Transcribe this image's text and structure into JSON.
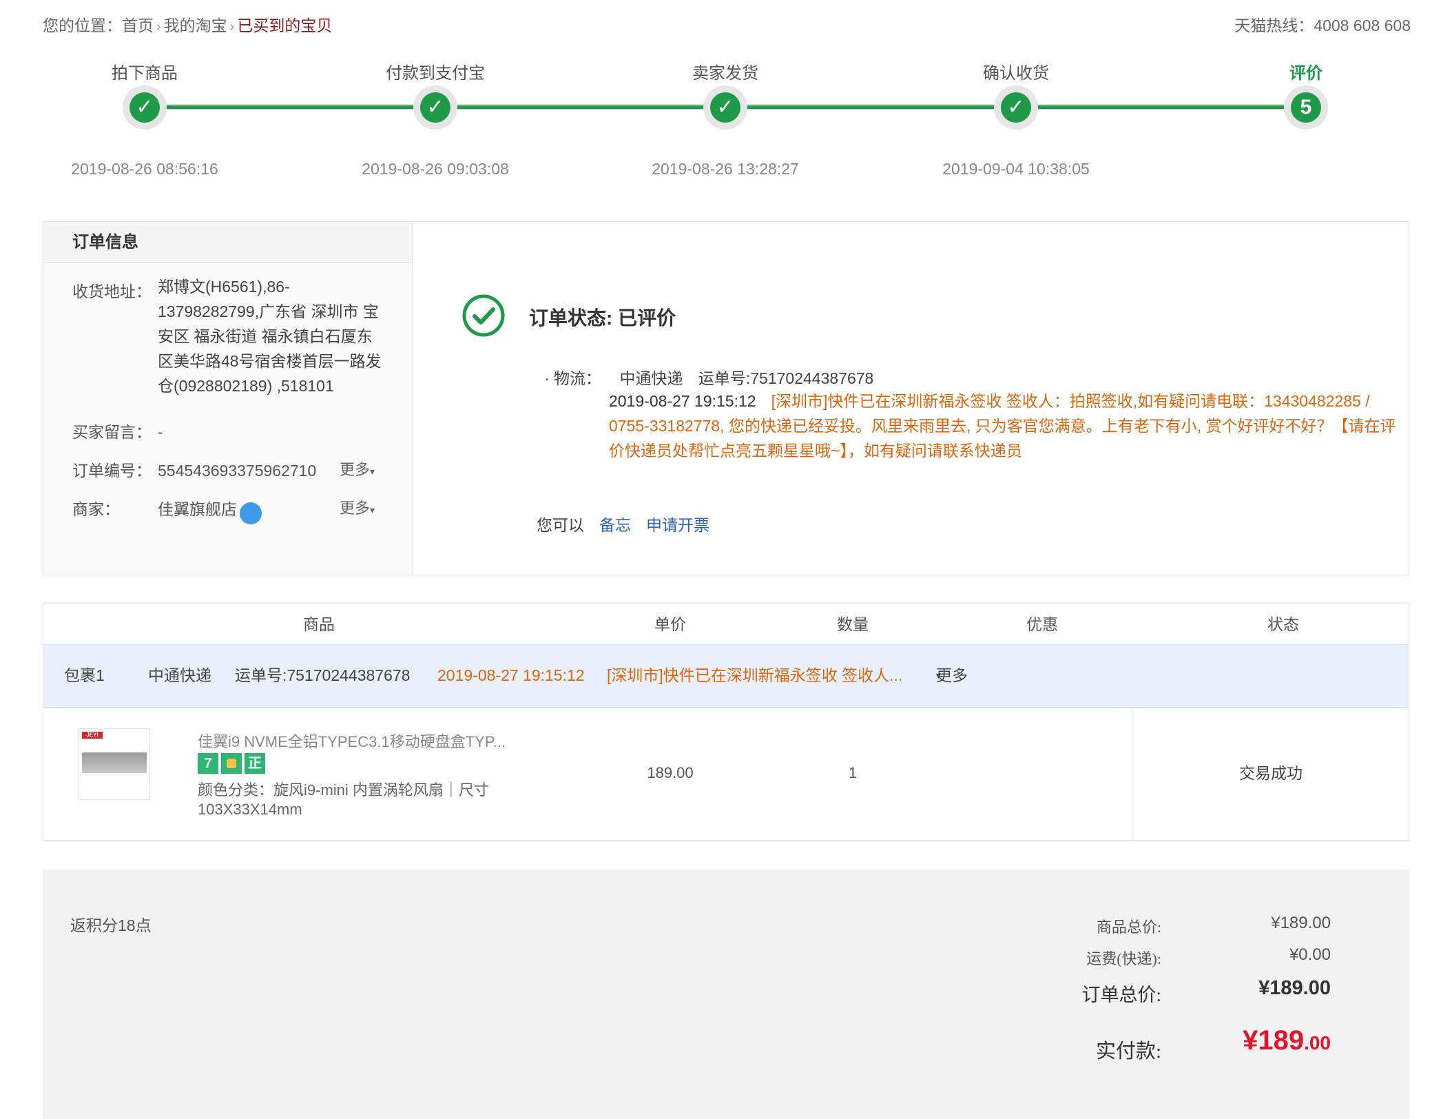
{
  "breadcrumb": {
    "label": "您的位置：",
    "items": [
      "首页",
      "我的淘宝",
      "已买到的宝贝"
    ]
  },
  "hotline": "天猫热线：4008 608 608",
  "progress": {
    "steps": [
      {
        "label": "拍下商品",
        "time": "2019-08-26 08:56:16",
        "mark": "check"
      },
      {
        "label": "付款到支付宝",
        "time": "2019-08-26 09:03:08",
        "mark": "check"
      },
      {
        "label": "卖家发货",
        "time": "2019-08-26 13:28:27",
        "mark": "check"
      },
      {
        "label": "确认收货",
        "time": "2019-09-04 10:38:05",
        "mark": "check"
      },
      {
        "label": "评价",
        "time": "",
        "mark": "5"
      }
    ]
  },
  "order_info": {
    "title": "订单信息",
    "address_label": "收货地址：",
    "address": "郑博文(H6561),86-13798282799,广东省 深圳市 宝安区 福永街道 福永镇白石厦东区美华路48号宿舍楼首层一路发仓(0928802189) ,518101",
    "message_label": "买家留言：",
    "message": "-",
    "order_no_label": "订单编号：",
    "order_no": "554543693375962710",
    "seller_label": "商家：",
    "seller": "佳翼旗舰店",
    "more": "更多"
  },
  "status": {
    "title": "订单状态: 已评价",
    "logistics_label": "· 物流：",
    "carrier": "中通快递",
    "waybill": "运单号:75170244387678",
    "detail_time": "2019-08-27 19:15:12",
    "detail_text": "[深圳市]快件已在深圳新福永签收 签收人：拍照签收,如有疑问请电联：13430482285 / 0755-33182778, 您的快递已经妥投。风里来雨里去, 只为客官您满意。上有老下有小, 赏个好评好不好？【请在评价快递员处帮忙点亮五颗星星哦~】，如有疑问请联系快递员",
    "you_can": "您可以",
    "actions": [
      "备忘",
      "申请开票"
    ]
  },
  "table": {
    "headers": [
      "商品",
      "单价",
      "数量",
      "优惠",
      "状态"
    ],
    "package": {
      "name": "包裹1",
      "carrier": "中通快递",
      "waybill": "运单号:75170244387678",
      "time": "2019-08-27 19:15:12",
      "text": "[深圳市]快件已在深圳新福永签收 签收人...",
      "more": "更多"
    },
    "item": {
      "brand_mark": "JEYI",
      "name": "佳翼i9 NVME全铝TYPEC3.1移动硬盘盒TYP...",
      "badges": [
        "7",
        "",
        "正"
      ],
      "sku": "颜色分类：旋风i9-mini 内置涡轮风扇｜尺寸 103X33X14mm",
      "price": "189.00",
      "qty": "1",
      "discount": "",
      "status": "交易成功"
    }
  },
  "summary": {
    "points": "返积分18点",
    "goods_total_label": "商品总价:",
    "goods_total": "¥189.00",
    "shipping_label": "运费(快递):",
    "shipping": "¥0.00",
    "order_total_label": "订单总价:",
    "order_total": "¥189.00",
    "paid_label": "实付款:",
    "paid_main": "¥189",
    "paid_cents": ".00"
  },
  "colors": {
    "green": "#1f9a48",
    "orange": "#e0660e",
    "link": "#2a66b4",
    "price_red": "#e4142a"
  }
}
